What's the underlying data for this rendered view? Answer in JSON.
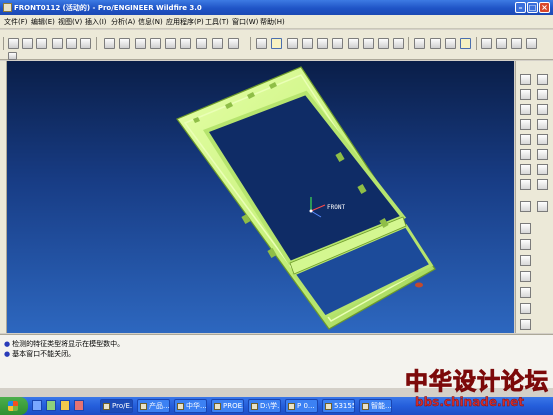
{
  "window": {
    "title": "FRONT0112 (活动的) - Pro/ENGINEER Wildfire 3.0"
  },
  "menu": [
    {
      "label": "文件(F)"
    },
    {
      "label": "编辑(E)"
    },
    {
      "label": "视图(V)"
    },
    {
      "label": "插入(I)"
    },
    {
      "label": "分析(A)"
    },
    {
      "label": "信息(N)"
    },
    {
      "label": "应用程序(P)"
    },
    {
      "label": "工具(T)"
    },
    {
      "label": "窗口(W)"
    },
    {
      "label": "帮助(H)"
    }
  ],
  "viewport": {
    "coordinate_label": "FRONT",
    "background_top": "#0a1e48",
    "background_bottom": "#2d67bf",
    "model_color": "#c9f27e"
  },
  "messages": [
    {
      "text": "检测的特征类型将显示在模型数中。"
    },
    {
      "text": "基本窗口不能关闭。"
    }
  ],
  "taskbar": {
    "tasks": [
      {
        "label": "Pro/E..."
      },
      {
        "label": "产品..."
      },
      {
        "label": "中华..."
      },
      {
        "label": "PROE..."
      },
      {
        "label": "D:\\学..."
      },
      {
        "label": "P 0..."
      },
      {
        "label": "53155..."
      },
      {
        "label": "智能..."
      }
    ]
  },
  "watermark": {
    "title": "中华设计论坛",
    "url": "bbs.chinade.net"
  }
}
